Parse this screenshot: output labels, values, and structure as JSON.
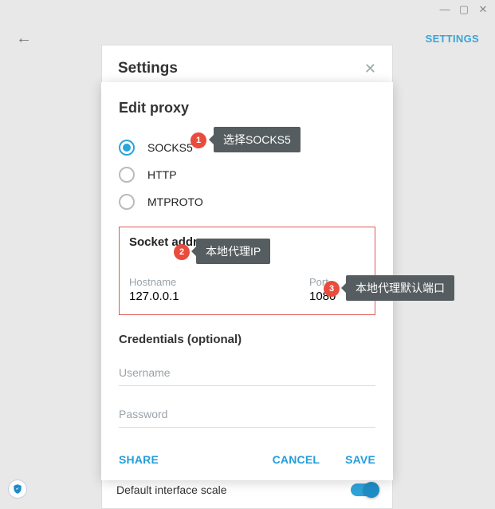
{
  "window_controls": {
    "min": "—",
    "max": "▢",
    "close": "✕"
  },
  "header": {
    "settings_link": "SETTINGS"
  },
  "panel": {
    "title": "Settings"
  },
  "dialog": {
    "title": "Edit proxy",
    "radio": {
      "socks5": "SOCKS5",
      "http": "HTTP",
      "mtproto": "MTPROTO"
    },
    "socket": {
      "header": "Socket address",
      "hostname_label": "Hostname",
      "hostname_value": "127.0.0.1",
      "port_label": "Port",
      "port_value": "1080"
    },
    "credentials": {
      "header": "Credentials (optional)",
      "username_placeholder": "Username",
      "password_placeholder": "Password"
    },
    "actions": {
      "share": "SHARE",
      "cancel": "CANCEL",
      "save": "SAVE"
    }
  },
  "bottom": {
    "default_scale": "Default interface scale"
  },
  "annotations": {
    "n1": "1",
    "tip1": "选择SOCKS5",
    "n2": "2",
    "tip2": "本地代理IP",
    "n3": "3",
    "tip3": "本地代理默认端口"
  }
}
